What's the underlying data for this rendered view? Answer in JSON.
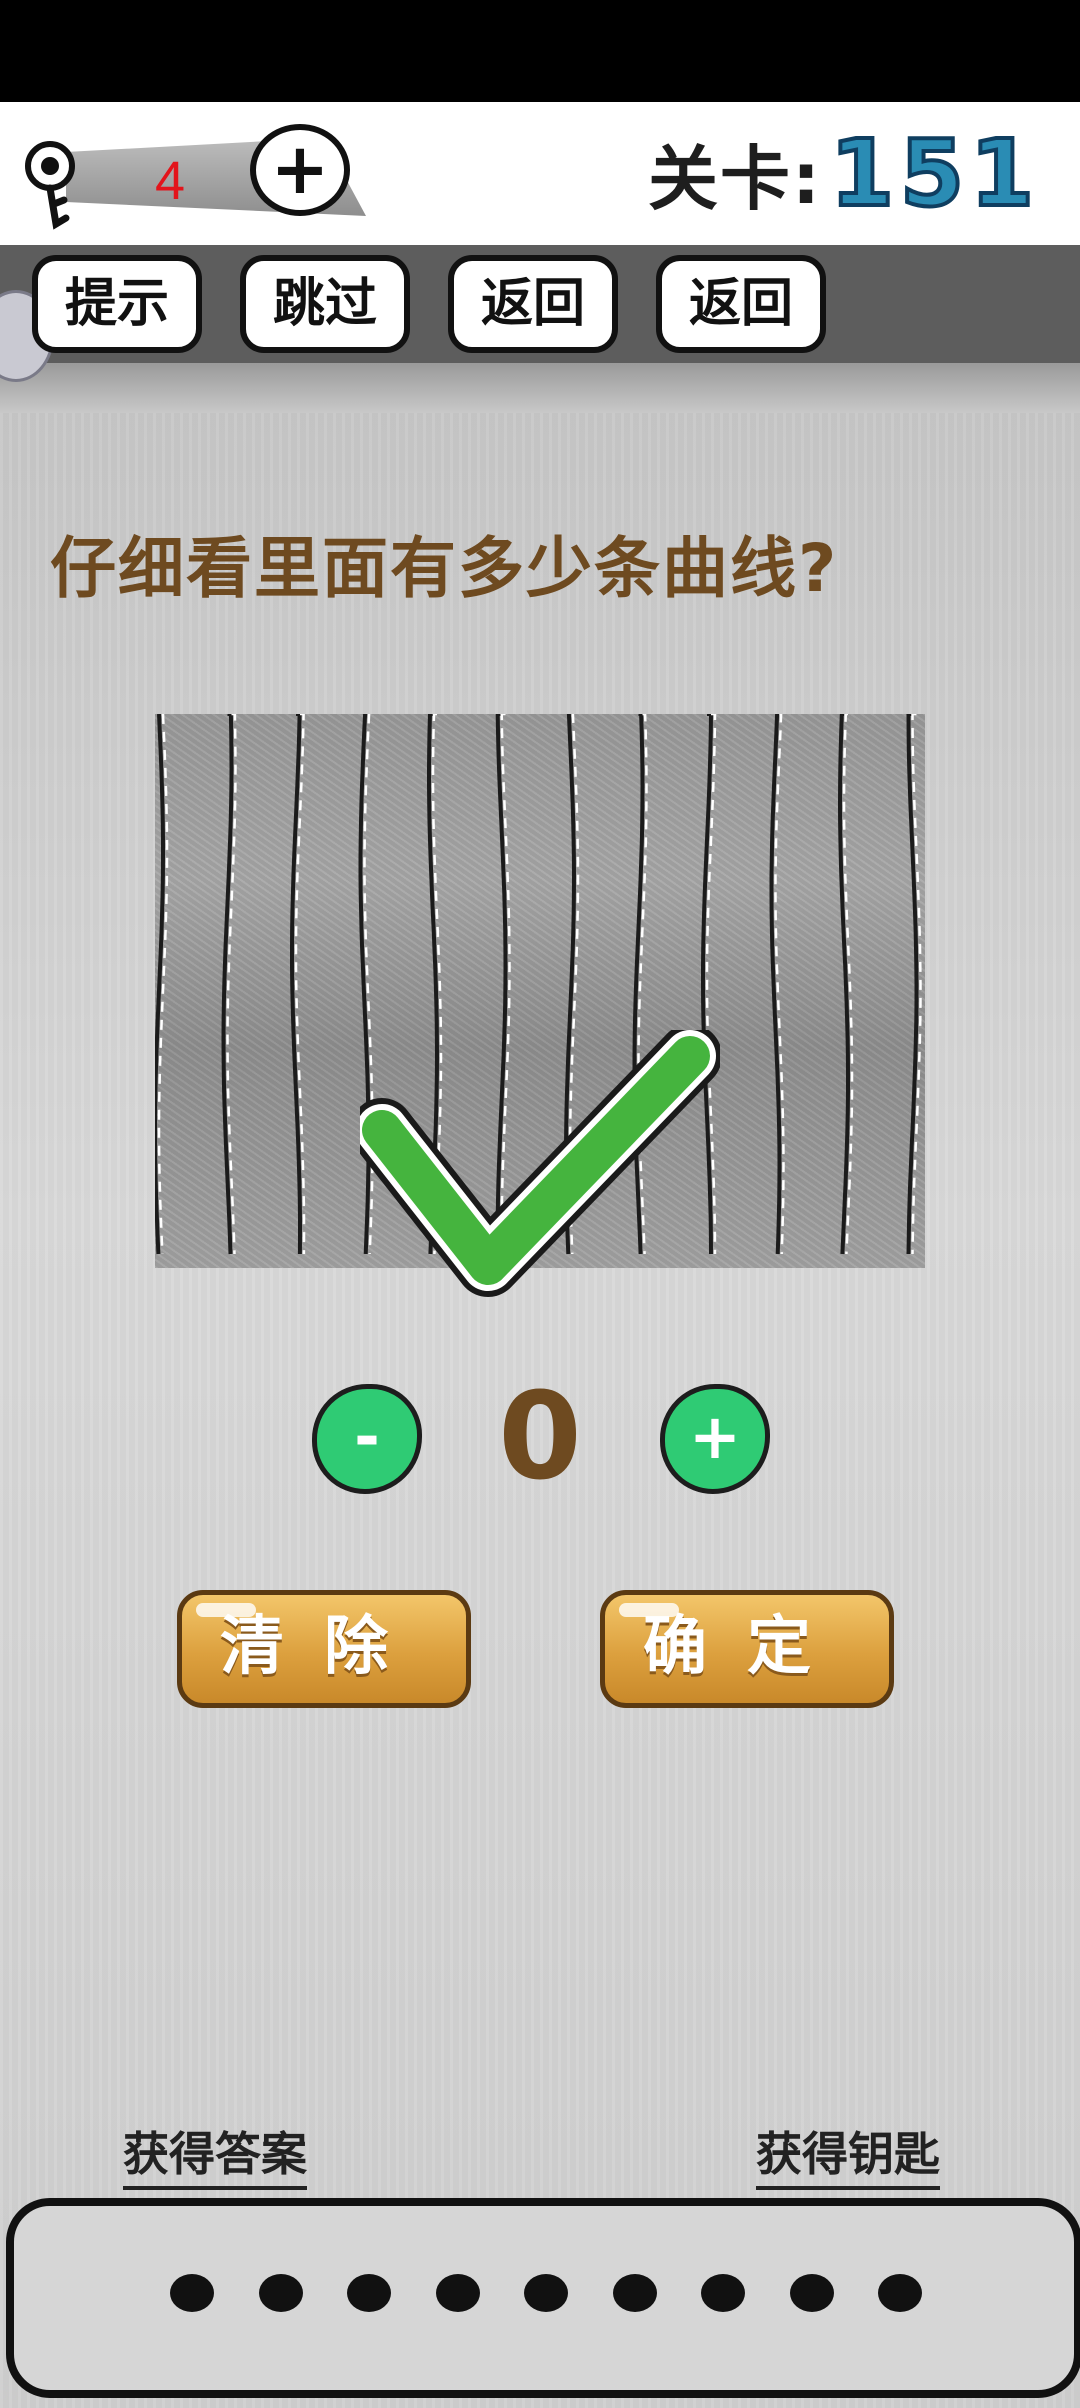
{
  "header": {
    "key_count": "4",
    "key_plus_label": "+",
    "level_label": "关卡:",
    "level_number": "151"
  },
  "toolbar": {
    "buttons": [
      {
        "label": "提示"
      },
      {
        "label": "跳过"
      },
      {
        "label": "返回"
      },
      {
        "label": "返回"
      }
    ]
  },
  "question": {
    "text": "仔细看里面有多少条曲线?"
  },
  "puzzle": {
    "icon": "wavy-lines-illusion",
    "result_icon": "checkmark-icon",
    "result_color": "#45b43e"
  },
  "counter": {
    "minus_label": "-",
    "value": "0",
    "plus_label": "+"
  },
  "actions": {
    "clear_label": "清除",
    "confirm_label": "确定"
  },
  "footer": {
    "get_answer_label": "获得答案",
    "get_key_label": "获得钥匙",
    "answer_dots": 9
  }
}
